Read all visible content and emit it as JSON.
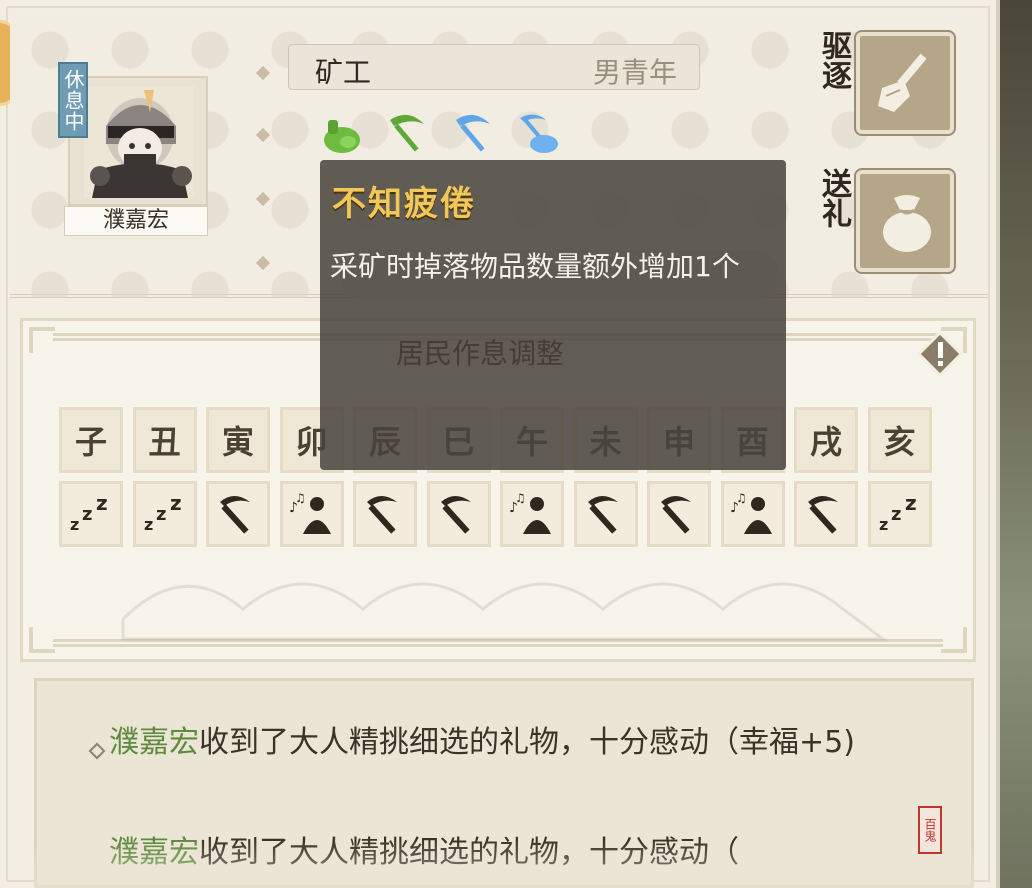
{
  "resident": {
    "status_badge": "休息中",
    "name": "濮嘉宏",
    "job": "矿工",
    "gender_age": "男青年"
  },
  "tools": [
    {
      "icon": "ore-bag-icon",
      "color": "#6dbb3f"
    },
    {
      "icon": "green-pickaxe-icon",
      "color": "#5ea83a"
    },
    {
      "icon": "blue-pickaxe-icon",
      "color": "#5fa6e8"
    },
    {
      "icon": "blue-ore-pickaxe-icon",
      "color": "#5fa6e8"
    }
  ],
  "actions": {
    "expel_label": "驱逐",
    "gift_label": "送礼"
  },
  "tooltip": {
    "title": "不知疲倦",
    "body": "采矿时掉落物品数量额外增加1个",
    "under_text": "居民作息调整"
  },
  "schedule": {
    "hours": [
      "子",
      "丑",
      "寅",
      "卯",
      "辰",
      "巳",
      "午",
      "未",
      "申",
      "酉",
      "戌",
      "亥"
    ],
    "activities": [
      "sleep",
      "sleep",
      "mine",
      "leisure",
      "mine",
      "mine",
      "leisure",
      "mine",
      "mine",
      "leisure",
      "mine",
      "sleep"
    ]
  },
  "log": {
    "entries": [
      {
        "who": "濮嘉宏",
        "text": "收到了大人精挑细选的礼物，十分感动（幸福+5)"
      },
      {
        "who": "濮嘉宏",
        "text": "收到了大人精挑细选的礼物，十分感动（"
      }
    ],
    "seal_text": "百鬼"
  }
}
